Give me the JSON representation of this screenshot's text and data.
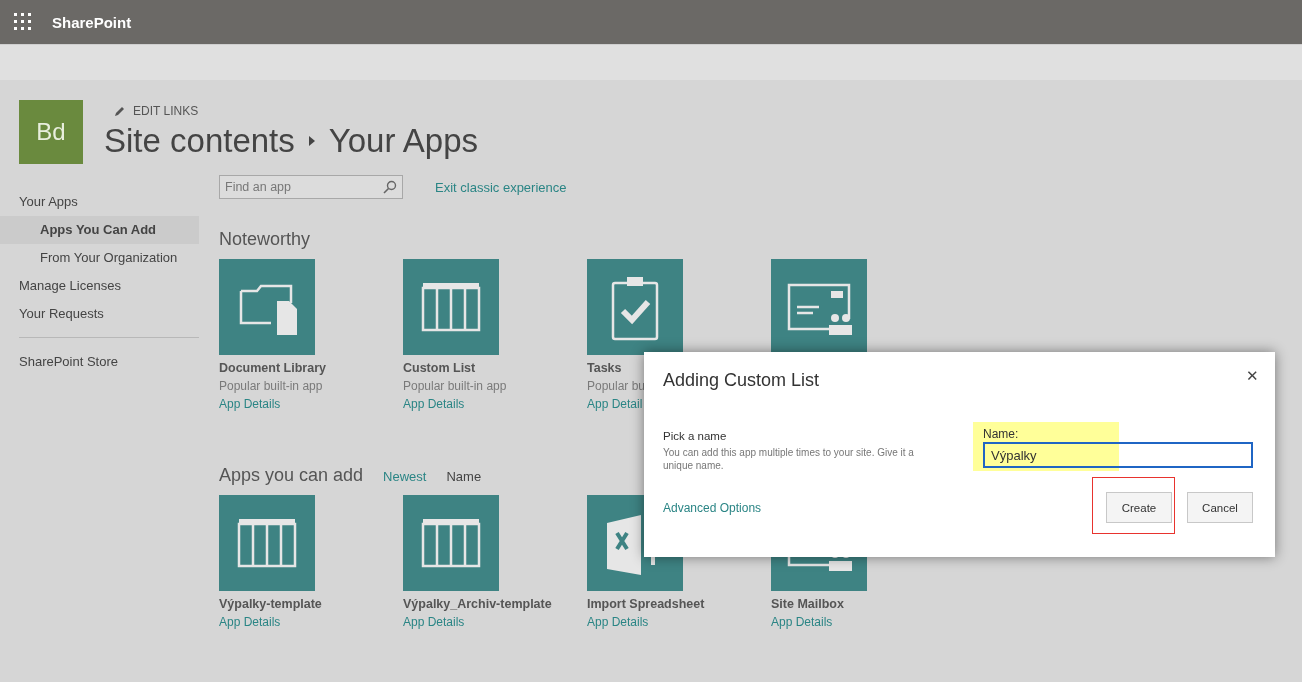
{
  "suite_bar": {
    "app_name": "SharePoint"
  },
  "header": {
    "logo_text": "Bd",
    "edit_links": "EDIT LINKS",
    "title": "Site contents",
    "subtitle": "Your Apps"
  },
  "nav": {
    "items": [
      {
        "label": "Your Apps",
        "selected": false,
        "children": [
          {
            "label": "Apps You Can Add",
            "selected": true
          },
          {
            "label": "From Your Organization",
            "selected": false
          }
        ]
      },
      {
        "label": "Manage Licenses",
        "selected": false
      },
      {
        "label": "Your Requests",
        "selected": false
      }
    ],
    "store_items": [
      {
        "label": "SharePoint Store",
        "selected": false
      }
    ]
  },
  "search": {
    "placeholder": "Find an app"
  },
  "exit_link": "Exit classic experience",
  "noteworthy": {
    "heading": "Noteworthy",
    "tiles": [
      {
        "kind": "library",
        "title": "Document Library",
        "subtitle": "Popular built-in app",
        "link": "App Details"
      },
      {
        "kind": "list",
        "title": "Custom List",
        "subtitle": "Popular built-in app",
        "link": "App Details"
      },
      {
        "kind": "tasks",
        "title": "Tasks",
        "subtitle": "Popular bu",
        "link": "App Detail"
      },
      {
        "kind": "mailbox"
      }
    ]
  },
  "apps": {
    "heading": "Apps you can add",
    "sort_options": [
      {
        "label": "Newest",
        "selected": false
      },
      {
        "label": "Name",
        "selected": true
      }
    ],
    "tiles": [
      {
        "kind": "list",
        "title": "Výpalky-template",
        "link": "App Details"
      },
      {
        "kind": "list",
        "title": "Výpalky_Archiv-template",
        "link": "App Details"
      },
      {
        "kind": "excel",
        "title": "Import Spreadsheet",
        "link": "App Details"
      },
      {
        "kind": "mailbox",
        "title": "Site Mailbox",
        "link": "App Details"
      }
    ]
  },
  "dialog": {
    "title": "Adding Custom List",
    "close": "✕",
    "section_title": "Pick a name",
    "description": "You can add this app multiple times to your site. Give it a unique name.",
    "field_label": "Name:",
    "field_value": "Výpalky",
    "advanced_link": "Advanced Options",
    "buttons": [
      {
        "label": "Create",
        "highlighted": true
      },
      {
        "label": "Cancel",
        "highlighted": false
      }
    ]
  }
}
